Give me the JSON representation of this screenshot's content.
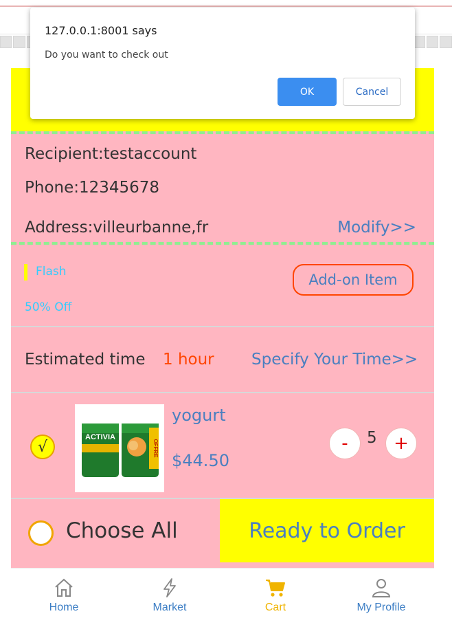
{
  "dialog": {
    "title": "127.0.0.1:8001 says",
    "message": "Do you want to check out",
    "ok_label": "OK",
    "cancel_label": "Cancel"
  },
  "address": {
    "recipient": "Recipient:testaccount",
    "phone": "Phone:12345678",
    "address": "Address:villeurbanne,fr",
    "modify_label": "Modify>>"
  },
  "promo": {
    "flash_label": "Flash",
    "discount_label": "50% Off",
    "addon_label": "Add-on Item"
  },
  "delivery": {
    "label": "Estimated time",
    "value": "1 hour",
    "specify_label": "Specify Your Time>>"
  },
  "cart_item": {
    "selected_mark": "√",
    "name": "yogurt",
    "price": "$44.50",
    "quantity": "5",
    "minus_label": "-",
    "plus_label": "+",
    "image_brand": "ACTIVIA",
    "image_badge": "OFFRE"
  },
  "footer": {
    "choose_all_label": "Choose All",
    "order_label": "Ready to Order"
  },
  "tabbar": {
    "home": "Home",
    "market": "Market",
    "cart": "Cart",
    "profile": "My Profile"
  },
  "colors": {
    "pink": "#ffb6c1",
    "yellow": "#ffff00",
    "link_blue": "#4a7fc0",
    "accent_orange": "#ff4500",
    "cyan": "#33ccff",
    "dash_green": "#90ee90"
  }
}
